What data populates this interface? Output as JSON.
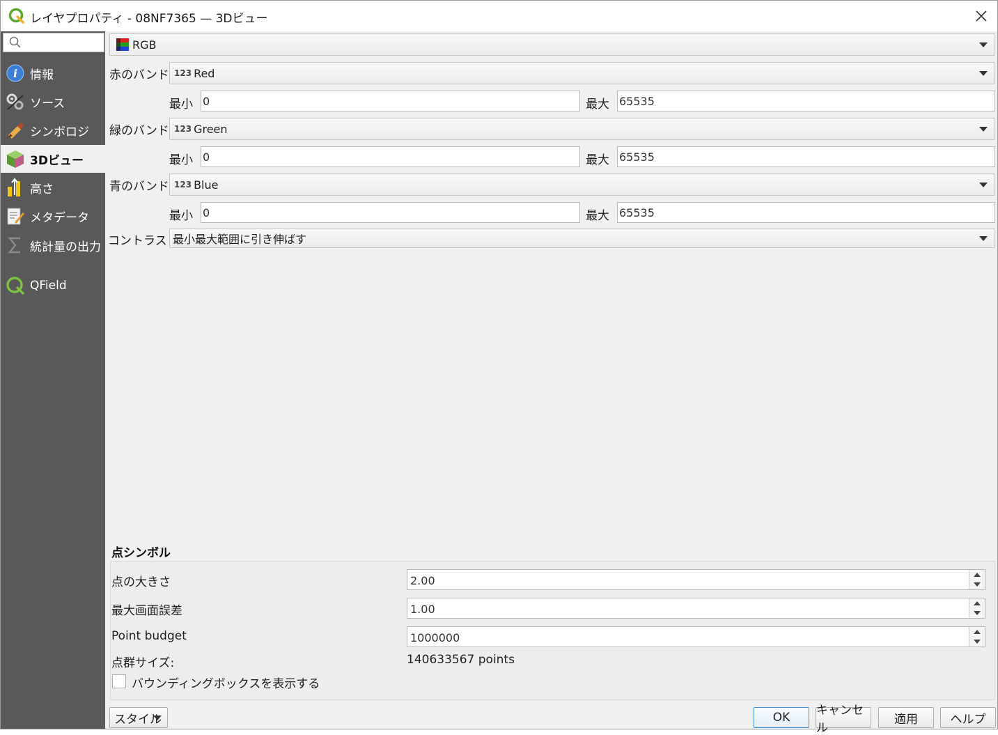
{
  "window": {
    "title": "レイヤプロパティ - 08NF7365 — 3Dビュー"
  },
  "sidebar": {
    "search_placeholder": "",
    "items": [
      {
        "label": "情報",
        "icon": "info-icon"
      },
      {
        "label": "ソース",
        "icon": "source-icon"
      },
      {
        "label": "シンボロジ",
        "icon": "symbology-icon"
      },
      {
        "label": "3Dビュー",
        "icon": "3d-view-icon",
        "active": true
      },
      {
        "label": "高さ",
        "icon": "elevation-icon"
      },
      {
        "label": "メタデータ",
        "icon": "metadata-icon"
      },
      {
        "label": "統計量の出力",
        "icon": "statistics-icon"
      },
      {
        "label": "QField",
        "icon": "qfield-icon"
      }
    ]
  },
  "renderer": {
    "selected": "RGB"
  },
  "bands": {
    "red_label": "赤のバンド",
    "red_value": "Red",
    "green_label": "緑のバンド",
    "green_value": "Green",
    "blue_label": "青のバンド",
    "blue_value": "Blue",
    "badge": "123",
    "min_label": "最小",
    "max_label": "最大",
    "red_min": "0",
    "red_max": "65535",
    "green_min": "0",
    "green_max": "65535",
    "blue_min": "0",
    "blue_max": "65535",
    "contrast_label": "コントラスト",
    "contrast_value": "最小最大範囲に引き伸ばす"
  },
  "point_symbol": {
    "section_title": "点シンボル",
    "point_size_label": "点の大きさ",
    "point_size_value": "2.00",
    "max_error_label": "最大画面誤差",
    "max_error_value": "1.00",
    "budget_label": "Point budget",
    "budget_value": "1000000",
    "cloud_size_label": "点群サイズ:",
    "cloud_size_value": "140633567 points",
    "bbox_checkbox_label": "バウンディングボックスを表示する"
  },
  "buttons": {
    "style": "スタイル",
    "ok": "OK",
    "cancel": "キャンセル",
    "apply": "適用",
    "help": "ヘルプ"
  }
}
